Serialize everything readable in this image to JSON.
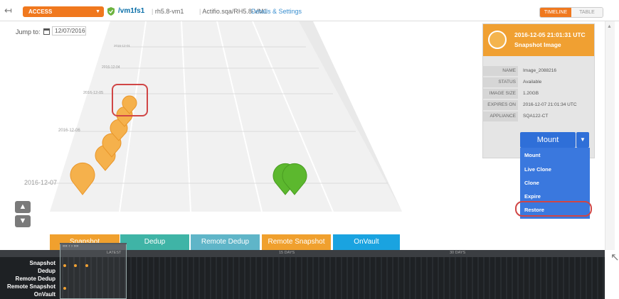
{
  "topbar": {
    "access_label": "ACCESS",
    "vm_name": "/vm1fs1",
    "host": "rh5.8-vm1",
    "app_path": "Actifio.sqa/RH5.8-VM1",
    "details_link": "Details & Settings",
    "view_timeline": "TIMELINE",
    "view_table": "TABLE"
  },
  "jump": {
    "label": "Jump to:",
    "date": "12/07/2016"
  },
  "timeline": {
    "date_labels": [
      "2016-12-01",
      "2016-12-04",
      "2016-12-05",
      "2016-12-06",
      "2016-12-07"
    ],
    "lanes": [
      "Snapshot",
      "Dedup",
      "Remote Dedup",
      "Remote Snapshot",
      "OnVault"
    ],
    "lane_colors": [
      "#f0a02e",
      "#3fb4a6",
      "#5fb5c8",
      "#f0a02e",
      "#1aa3e0"
    ]
  },
  "details": {
    "title": "2016-12-05 21:01:31 UTC",
    "subtitle": "Snapshot Image",
    "fields": [
      {
        "key": "NAME",
        "value": "Image_2088216"
      },
      {
        "key": "STATUS",
        "value": "Available"
      },
      {
        "key": "IMAGE SIZE",
        "value": "1.20GB"
      },
      {
        "key": "EXPIRES ON",
        "value": "2016-12-07 21:01:34 UTC"
      },
      {
        "key": "APPLIANCE",
        "value": "SQA122-CT"
      }
    ]
  },
  "mount": {
    "button": "Mount",
    "menu": [
      "Mount",
      "Live Clone",
      "Clone",
      "Expire",
      "Restore"
    ]
  },
  "nav": {
    "up": "▲",
    "down": "▼"
  },
  "bottom": {
    "window_label": "«« ‹        › »»",
    "latest": "LATEST",
    "days15": "15 DAYS",
    "days30": "30 DAYS",
    "rows": [
      "Snapshot",
      "Dedup",
      "Remote Dedup",
      "Remote Snapshot",
      "OnVault"
    ]
  },
  "colors": {
    "accent": "#f0781e",
    "pin": "#f0a02e",
    "pin_green": "#5cb82e",
    "mount": "#2f6fd8",
    "ring": "#d04646"
  }
}
